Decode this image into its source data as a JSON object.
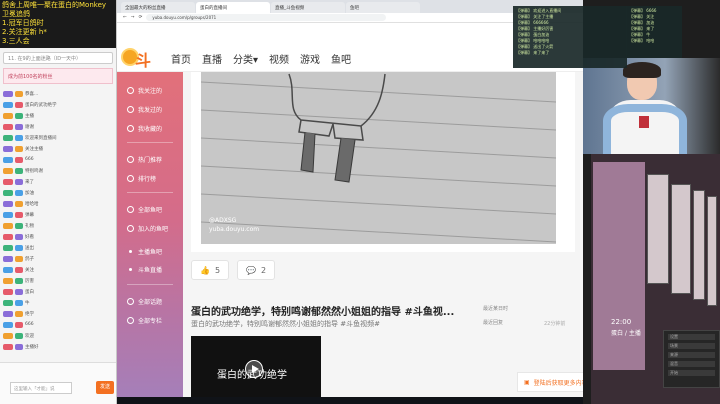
{
  "chat": {
    "banner_lines": [
      "鸽舍上周唯一聚在蛋白的Monkey",
      "卫冕追鸽",
      "1.冠军日鸽时",
      "2.关注更新 h*",
      "3.三人会"
    ],
    "search_placeholder": "11. 在9的上面迷路（ID一天中）",
    "fans_text": "成为前100名的粉丝",
    "lines": [
      "恭喜...",
      "蛋白的武功绝学",
      "主播",
      "谢谢",
      "欢迎来到直播间",
      "关注主播",
      "666",
      "特别鸣谢",
      "来了",
      "加油",
      "哈哈哈",
      "弹幕",
      "礼物",
      "好看",
      "送出",
      "鸽子",
      "关注",
      "厉害",
      "蛋白",
      "牛",
      "绝学",
      "666",
      "欢迎",
      "主播好"
    ],
    "input_placeholder": "这里输入「才能」说",
    "send_label": "发送"
  },
  "browser": {
    "tabs": [
      "全国最大的粉丝直播",
      "蛋白的直播间",
      "直播_斗鱼视频",
      "鱼吧"
    ],
    "address": "yuba.douyu.com/p/groups/2071"
  },
  "site": {
    "logo": "斗鱼",
    "nav": [
      "首页",
      "直播",
      "分类▾",
      "视频",
      "游戏",
      "鱼吧"
    ]
  },
  "sidebar": {
    "items": [
      "我关注的",
      "我发过的",
      "我收藏的",
      "热门推荐",
      "排行榜",
      "全部鱼吧",
      "加入的鱼吧",
      "主播鱼吧",
      "斗鱼直播",
      "全部话题",
      "全部专栏"
    ]
  },
  "post": {
    "watermark": "@ADXSG\nyuba.douyu.com",
    "likes": "5",
    "comments": "2",
    "title": "蛋白的武功绝学，特别鸣谢郁然然小姐姐的指导 #斗鱼视...",
    "subtitle": "蛋白的武功绝学，特别鸣谢郁然然小姐姐的指导 #斗鱼视频#",
    "meta_1": "最近某日时",
    "meta_2": "最近回复",
    "time": "22分钟前",
    "video_title": "蛋白的武功绝学",
    "float_label": "登陆后获取更多内容"
  },
  "overlay": {
    "chat_lines": [
      "【弹幕】 欢迎进入直播间",
      "【弹幕】 关注了主播",
      "【弹幕】 666666",
      "【弹幕】 主播好厉害",
      "【弹幕】 蛋白加油",
      "【弹幕】 哈哈哈哈",
      "【弹幕】 送出了火箭",
      "【弹幕】 来了来了"
    ],
    "chat_lines2": [
      "【弹幕】 6666",
      "【弹幕】 关注",
      "【弹幕】 加油",
      "【弹幕】 来了",
      "【弹幕】 牛",
      "【弹幕】 哈哈"
    ],
    "pip_text": "22:00",
    "pip_text2": "蛋白 / 主播",
    "panel_rows": [
      "设置",
      "场景",
      "来源",
      "混音",
      "开始"
    ]
  },
  "colors": {
    "accent": "#f37021",
    "sidebar_top": "#e2707a",
    "sidebar_bottom": "#a57fb9"
  }
}
